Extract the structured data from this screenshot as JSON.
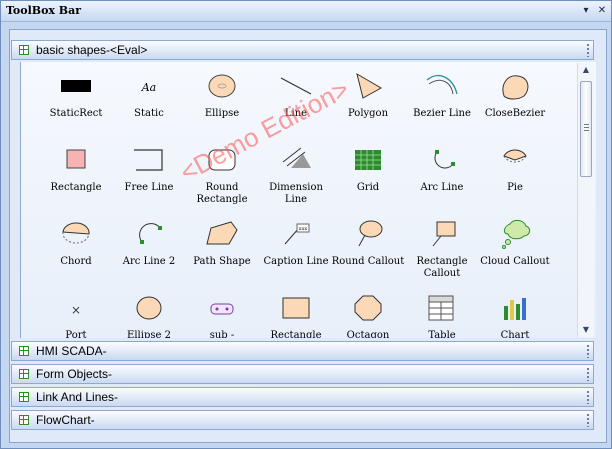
{
  "window": {
    "title": "ToolBox Bar",
    "dropdown_icon": "chevron-down-icon",
    "close_icon": "close-icon"
  },
  "groups_top": {
    "label": "basic shapes-<Eval>"
  },
  "items": [
    {
      "id": "staticrect",
      "label": "StaticRect",
      "icon": "static-rect-icon"
    },
    {
      "id": "static",
      "label": "Static",
      "icon": "static-text-icon"
    },
    {
      "id": "ellipse",
      "label": "Ellipse",
      "icon": "ellipse-icon"
    },
    {
      "id": "line",
      "label": "Line",
      "icon": "line-icon"
    },
    {
      "id": "polygon",
      "label": "Polygon",
      "icon": "polygon-icon"
    },
    {
      "id": "bezierline",
      "label": "Bezier Line",
      "icon": "bezier-line-icon"
    },
    {
      "id": "closebezier",
      "label": "CloseBezier",
      "icon": "close-bezier-icon"
    },
    {
      "id": "rectangle",
      "label": "Rectangle",
      "icon": "rectangle-icon"
    },
    {
      "id": "freeline",
      "label": "Free Line",
      "icon": "free-line-icon"
    },
    {
      "id": "roundrect",
      "label": "Round Rectangle",
      "icon": "round-rectangle-icon"
    },
    {
      "id": "dimline",
      "label": "Dimension Line",
      "icon": "dimension-line-icon"
    },
    {
      "id": "grid",
      "label": "Grid",
      "icon": "grid-icon"
    },
    {
      "id": "arcline",
      "label": "Arc Line",
      "icon": "arc-line-icon"
    },
    {
      "id": "pie",
      "label": "Pie",
      "icon": "pie-icon"
    },
    {
      "id": "chord",
      "label": "Chord",
      "icon": "chord-icon"
    },
    {
      "id": "arcline2",
      "label": "Arc Line 2",
      "icon": "arc-line-2-icon"
    },
    {
      "id": "pathshape",
      "label": "Path Shape",
      "icon": "path-shape-icon"
    },
    {
      "id": "captionline",
      "label": "Caption Line",
      "icon": "caption-line-icon"
    },
    {
      "id": "roundcallout",
      "label": "Round Callout",
      "icon": "round-callout-icon"
    },
    {
      "id": "rectcallout",
      "label": "Rectangle Callout",
      "icon": "rectangle-callout-icon"
    },
    {
      "id": "cloudcallout",
      "label": "Cloud Callout",
      "icon": "cloud-callout-icon"
    },
    {
      "id": "port",
      "label": "Port",
      "icon": "port-icon"
    },
    {
      "id": "ellipse2",
      "label": "Ellipse 2",
      "icon": "ellipse-2-icon"
    },
    {
      "id": "sub",
      "label": "sub -",
      "icon": "sub-icon"
    },
    {
      "id": "rectangle2",
      "label": "Rectangle",
      "icon": "rectangle-2-icon"
    },
    {
      "id": "octagon",
      "label": "Octagon",
      "icon": "octagon-icon"
    },
    {
      "id": "table",
      "label": "Table",
      "icon": "table-icon"
    },
    {
      "id": "chart",
      "label": "Chart",
      "icon": "chart-icon"
    }
  ],
  "groups_bottom": [
    {
      "label": "HMI SCADA-<Eval>"
    },
    {
      "label": "Form Objects-<Eval>"
    },
    {
      "label": "Link And Lines-<Eval>"
    },
    {
      "label": "FlowChart-<Eval>"
    }
  ],
  "watermark": "<Demo Edition>",
  "colors": {
    "shape_fill": "#fcd9b6",
    "accent_green": "#2e8b2e",
    "watermark": "#ff5050"
  }
}
